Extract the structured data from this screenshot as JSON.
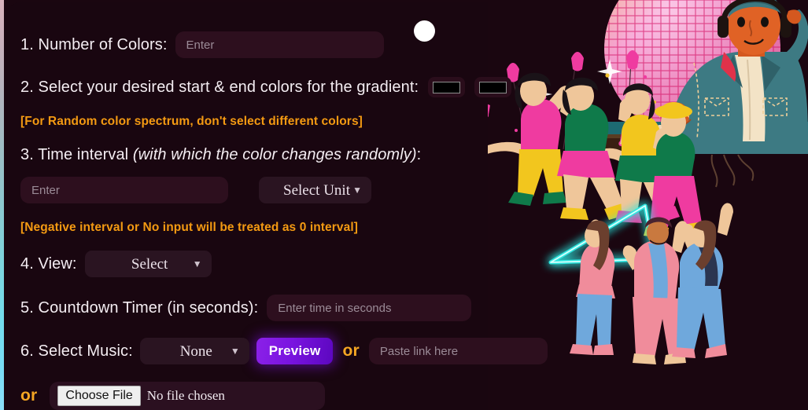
{
  "background": {
    "page_color": "#1a0610",
    "accent_warning_color": "#f49a12",
    "accent_or_color": "#f5a623",
    "preview_button_color": "#7a14e0",
    "edge_strip_top_color": "#d9b3bd",
    "edge_strip_bottom_color": "#8ce0fa"
  },
  "form": {
    "colors_count": {
      "label": "1. Number of Colors:",
      "input_placeholder": "Enter",
      "input_value": ""
    },
    "gradient_colors": {
      "label": "2. Select your desired start & end colors for the gradient:",
      "start_color_value": "#000000",
      "end_color_value": "#000000",
      "note": "[For Random color spectrum, don't select different colors]"
    },
    "time_interval": {
      "label_main": "3. Time interval ",
      "label_italic": "(with which the color changes randomly)",
      "label_end": ":",
      "input_placeholder": "Enter",
      "input_value": "",
      "unit_selected": "Select Unit",
      "unit_options": [
        "Select Unit"
      ],
      "note": "[Negative interval or No input will be treated as 0 interval]"
    },
    "view": {
      "label": "4. View:",
      "selected": "Select",
      "options": [
        "Select"
      ]
    },
    "countdown": {
      "label": "5. Countdown Timer (in seconds):",
      "input_placeholder": "Enter time in seconds",
      "input_value": ""
    },
    "music": {
      "label": "6. Select Music:",
      "selected": "None",
      "options": [
        "None"
      ],
      "preview_label": "Preview",
      "or_label": "or",
      "link_placeholder": "Paste link here",
      "link_value": ""
    },
    "file_upload": {
      "or_label": "or",
      "choose_label": "Choose File",
      "status": "No file chosen"
    }
  }
}
